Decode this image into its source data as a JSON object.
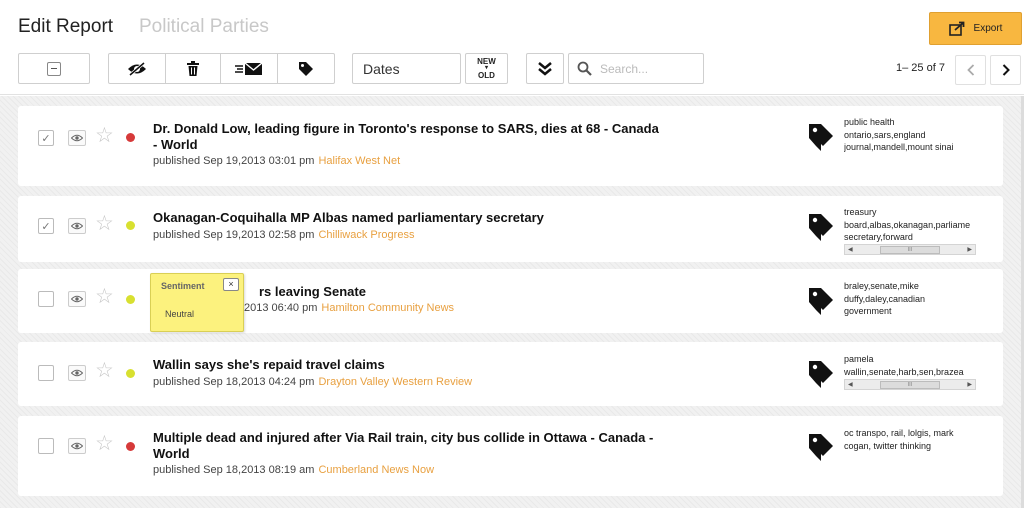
{
  "header": {
    "title": "Edit Report",
    "subtitle": "Political Parties",
    "export_label": "Export"
  },
  "toolbar": {
    "dates_label": "Dates",
    "sort_new": "NEW",
    "sort_old": "OLD",
    "search_placeholder": "Search...",
    "pager_text": "1– 25 of 7"
  },
  "articles": [
    {
      "headline": "Dr. Donald Low, leading figure in Toronto's response to SARS, dies at 68 - Canada - World",
      "published": "published Sep 19,2013 03:01 pm",
      "source": "Halifax West Net",
      "sentiment_color": "#d63a3a",
      "checked": true,
      "tags": [
        "public health",
        "ontario,sars,england",
        "journal,mandell,mount sinai"
      ],
      "tags_scrollbar": false
    },
    {
      "headline": "Okanagan-Coquihalla MP Albas named parliamentary secretary",
      "published": "published Sep 19,2013 02:58 pm",
      "source": "Chilliwack Progress",
      "sentiment_color": "#d8e030",
      "checked": true,
      "tags": [
        "treasury",
        "board,albas,okanagan,parliame",
        "secretary,forward"
      ],
      "tags_scrollbar": true
    },
    {
      "headline": "rs leaving Senate",
      "published": "2013 06:40 pm",
      "source": "Hamilton Community News",
      "sentiment_color": "#d8e030",
      "checked": false,
      "tags": [
        "braley,senate,mike",
        "duffy,daley,canadian",
        "government"
      ],
      "tags_scrollbar": false
    },
    {
      "headline": "Wallin says she's repaid travel claims",
      "published": "published Sep 18,2013 04:24 pm",
      "source": "Drayton Valley Western Review",
      "sentiment_color": "#d8e030",
      "checked": false,
      "tags": [
        "pamela",
        "wallin,senate,harb,sen,brazea"
      ],
      "tags_scrollbar": true
    },
    {
      "headline": "Multiple dead and injured after Via Rail train, city bus collide in Ottawa - Canada - World",
      "published": "published Sep 18,2013 08:19 am",
      "source": "Cumberland News Now",
      "sentiment_color": "#d63a3a",
      "checked": false,
      "tags": [
        "oc transpo, rail, lolgis, mark",
        "cogan, twitter thinking"
      ],
      "tags_scrollbar": false
    }
  ],
  "tooltip": {
    "title": "Sentiment",
    "close": "×",
    "body": "Neutral"
  },
  "scrollbar_thumb_label": "III"
}
